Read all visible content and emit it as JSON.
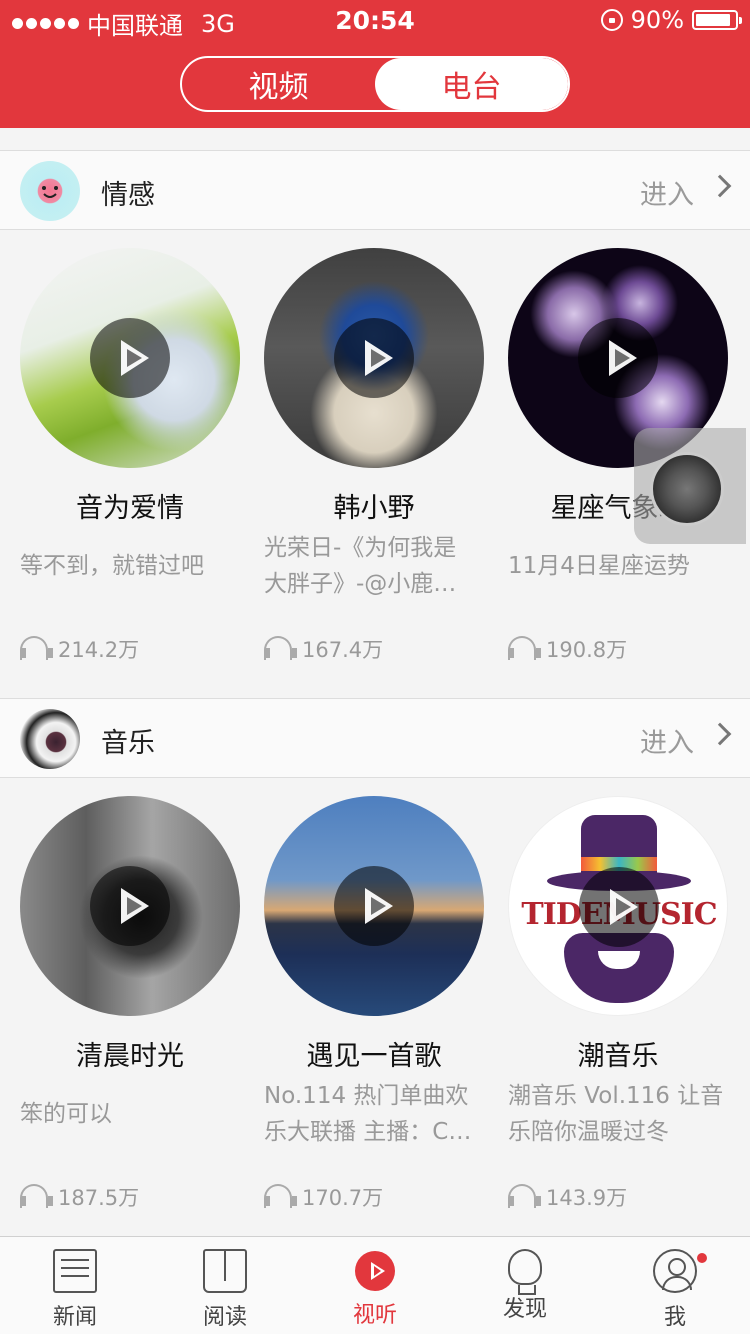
{
  "status_bar": {
    "carrier": "中国联通",
    "network": "3G",
    "time": "20:54",
    "battery_text": "90%",
    "battery_level": 0.9
  },
  "header": {
    "tabs": [
      {
        "label": "视频",
        "selected": false
      },
      {
        "label": "电台",
        "selected": true
      }
    ],
    "accent_color": "#e2373d"
  },
  "sections": [
    {
      "title": "情感",
      "enter_label": "进入",
      "items": [
        {
          "title": "音为爱情",
          "desc": "等不到，就错过吧",
          "count": "214.2万"
        },
        {
          "title": "韩小野",
          "desc": "光荣日-《为何我是大胖子》-@小鹿…",
          "desc_line1": "光荣日-《为何我是",
          "desc_line2": "大胖子》-@小鹿…",
          "count": "167.4万"
        },
        {
          "title": "星座气象站",
          "desc": "11月4日星座运势",
          "count": "190.8万"
        }
      ]
    },
    {
      "title": "音乐",
      "enter_label": "进入",
      "items": [
        {
          "title": "清晨时光",
          "desc": "笨的可以",
          "count": "187.5万"
        },
        {
          "title": "遇见一首歌",
          "desc_line1": "No.114 热门单曲欢",
          "desc_line2": "乐大联播 主播：C…",
          "count": "170.7万"
        },
        {
          "title": "潮音乐",
          "desc_line1": "潮音乐 Vol.116 让音",
          "desc_line2": "乐陪你温暖过冬",
          "count": "143.9万",
          "logo_text": "TIDEMUSIC"
        }
      ]
    }
  ],
  "tabbar": {
    "items": [
      {
        "label": "新闻",
        "icon": "news-icon"
      },
      {
        "label": "阅读",
        "icon": "book-icon"
      },
      {
        "label": "视听",
        "icon": "play-icon",
        "active": true
      },
      {
        "label": "发现",
        "icon": "bulb-icon"
      },
      {
        "label": "我",
        "icon": "user-icon",
        "badge": true
      }
    ]
  }
}
